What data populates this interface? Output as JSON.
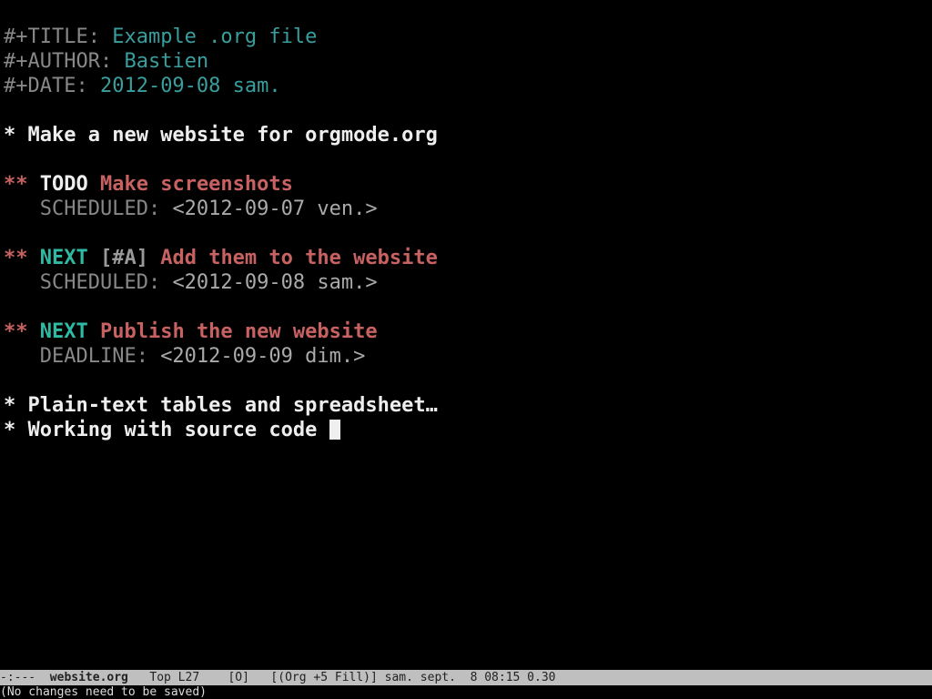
{
  "doc": {
    "title_key": "#+TITLE:",
    "title_val": " Example .org file",
    "author_key": "#+AUTHOR:",
    "author_val": " Bastien",
    "date_key": "#+DATE:",
    "date_val": " 2012-09-08 sam."
  },
  "h1a": "* Make a new website for orgmode.org",
  "t1": {
    "stars": "** ",
    "kw": "TODO",
    "rest": " Make screenshots",
    "sched_key": "   SCHEDULED: ",
    "sched_val": "<2012-09-07 ven.>"
  },
  "t2": {
    "stars": "** ",
    "kw": "NEXT",
    "prio": " [#A]",
    "rest": " Add them to the website",
    "sched_key": "   SCHEDULED: ",
    "sched_val": "<2012-09-08 sam.>"
  },
  "t3": {
    "stars": "** ",
    "kw": "NEXT",
    "rest": " Publish the new website",
    "dead_key": "   DEADLINE: ",
    "dead_val": "<2012-09-09 dim.>"
  },
  "h1b": "* Plain-text tables and spreadsheet…",
  "h1c": "* Working with source code ",
  "modeline": {
    "left": "-:--- ",
    "file": " website.org ",
    "rest": "  Top L27    [O]   [(Org +5 Fill)] sam. sept.  8 08:15 0.30"
  },
  "minibuffer": "(No changes need to be saved)"
}
